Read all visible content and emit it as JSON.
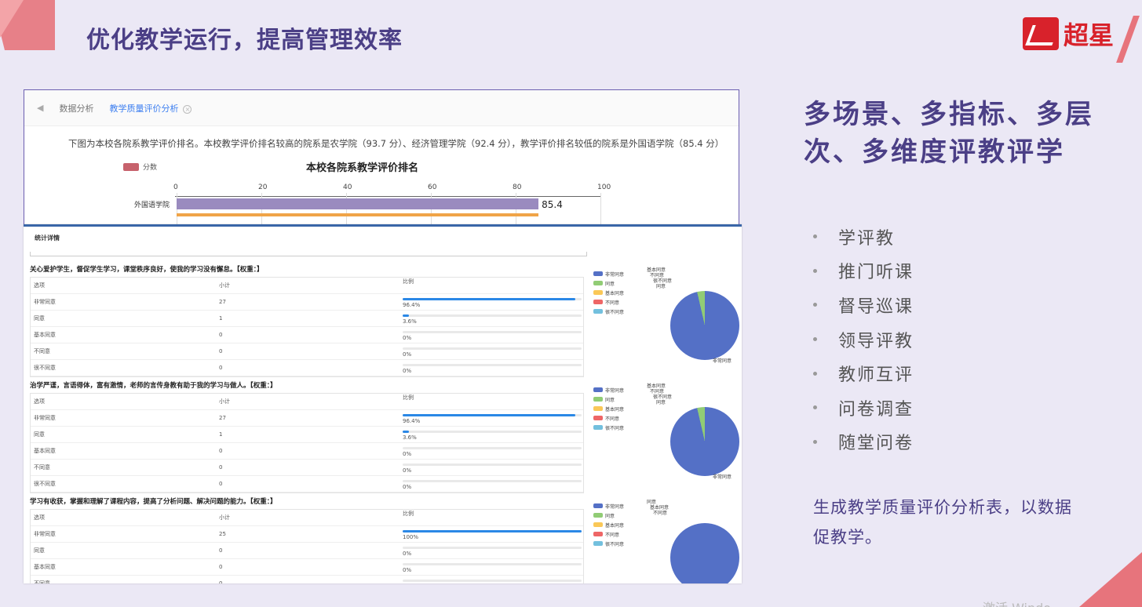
{
  "page": {
    "title": "优化教学运行，提高管理效率",
    "logo_text": "超星"
  },
  "shot1": {
    "tabs": [
      "数据分析",
      "教学质量评价分析"
    ],
    "description": "下图为本校各院系教学评价排名。本校教学评价排名较高的院系是农学院（93.7 分）、经济管理学院（92.4 分），教学评价排名较低的院系是外国语学院（85.4 分）",
    "legend_label": "分数",
    "chart_title": "本校各院系教学评价排名",
    "ticks": [
      "0",
      "20",
      "40",
      "60",
      "80",
      "100"
    ],
    "row_label": "外国语学院",
    "value_label": "85.4"
  },
  "chart_data": {
    "type": "bar",
    "title": "本校各院系教学评价排名",
    "categories": [
      "外国语学院"
    ],
    "series": [
      {
        "name": "分数",
        "values": [
          85.4
        ]
      }
    ],
    "xlim": [
      0,
      100
    ],
    "xticks": [
      0,
      20,
      40,
      60,
      80,
      100
    ]
  },
  "shot2": {
    "title": "统计详情",
    "headers": [
      "选项",
      "小计",
      "比例"
    ],
    "questions": [
      {
        "title": "关心爱护学生，督促学生学习，课堂秩序良好，使我的学习没有懈怠。【权重：】",
        "rows": [
          {
            "option": "非常同意",
            "count": "27",
            "pct": "96.4%",
            "fill": 0.964
          },
          {
            "option": "同意",
            "count": "1",
            "pct": "3.6%",
            "fill": 0.036
          },
          {
            "option": "基本同意",
            "count": "0",
            "pct": "0%",
            "fill": 0
          },
          {
            "option": "不同意",
            "count": "0",
            "pct": "0%",
            "fill": 0
          },
          {
            "option": "很不同意",
            "count": "0",
            "pct": "0%",
            "fill": 0
          }
        ],
        "legend": [
          "非常同意",
          "同意",
          "基本同意",
          "不同意",
          "很不同意"
        ],
        "pie_labels": [
          "基本同意",
          "不同意",
          "很不同意",
          "同意",
          "非常同意"
        ]
      },
      {
        "title": "治学严谨，言语得体，富有激情，老师的言传身教有助于我的学习与做人。【权重：】",
        "rows": [
          {
            "option": "非常同意",
            "count": "27",
            "pct": "96.4%",
            "fill": 0.964
          },
          {
            "option": "同意",
            "count": "1",
            "pct": "3.6%",
            "fill": 0.036
          },
          {
            "option": "基本同意",
            "count": "0",
            "pct": "0%",
            "fill": 0
          },
          {
            "option": "不同意",
            "count": "0",
            "pct": "0%",
            "fill": 0
          },
          {
            "option": "很不同意",
            "count": "0",
            "pct": "0%",
            "fill": 0
          }
        ],
        "legend": [
          "非常同意",
          "同意",
          "基本同意",
          "不同意",
          "很不同意"
        ],
        "pie_labels": [
          "基本同意",
          "不同意",
          "很不同意",
          "同意",
          "非常同意"
        ]
      },
      {
        "title": "学习有收获，掌握和理解了课程内容，提高了分析问题、解决问题的能力。【权重：】",
        "rows": [
          {
            "option": "非常同意",
            "count": "25",
            "pct": "100%",
            "fill": 1.0
          },
          {
            "option": "同意",
            "count": "0",
            "pct": "0%",
            "fill": 0
          },
          {
            "option": "基本同意",
            "count": "0",
            "pct": "0%",
            "fill": 0
          },
          {
            "option": "不同意",
            "count": "0",
            "pct": "0%",
            "fill": 0
          }
        ],
        "legend": [
          "非常同意",
          "同意",
          "基本同意",
          "不同意",
          "很不同意"
        ],
        "pie_labels": [
          "同意",
          "基本同意",
          "不同意",
          "很不同意"
        ]
      }
    ],
    "legend_colors": [
      "#5470c6",
      "#91cc75",
      "#fac858",
      "#ee6666",
      "#73c0de"
    ]
  },
  "right": {
    "heading": "多场景、多指标、多层次、多维度评教评学",
    "bullets": [
      "学评教",
      "推门听课",
      "督导巡课",
      "领导评教",
      "教师互评",
      "问卷调查",
      "随堂问卷"
    ],
    "summary": "生成教学质量评价分析表，以数据促教学。"
  },
  "watermark": "激活 Windo"
}
